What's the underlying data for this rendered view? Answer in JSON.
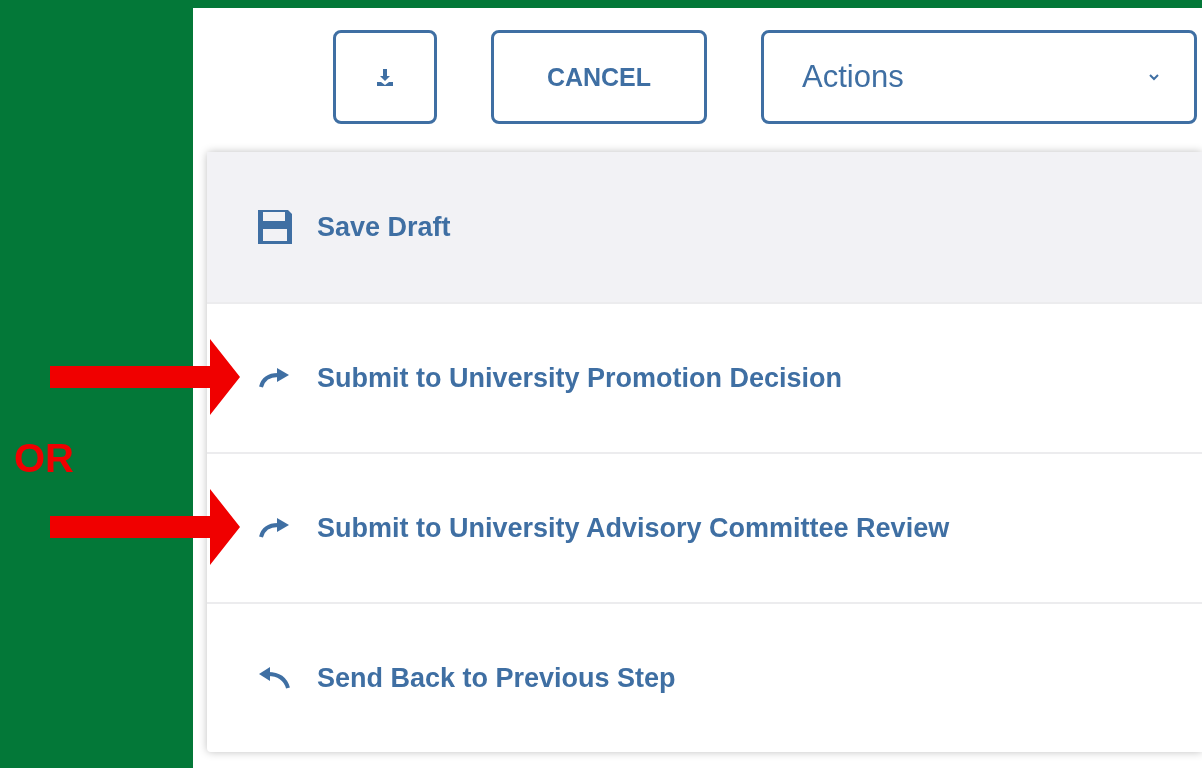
{
  "toolbar": {
    "download_button": {
      "kind": "download"
    },
    "cancel_button": "CANCEL",
    "actions_dropdown": {
      "label": "Actions",
      "expanded": true
    }
  },
  "menu_items": [
    {
      "kind": "save",
      "label": "Save Draft",
      "selected": true,
      "marked": false
    },
    {
      "kind": "forward",
      "label": "Submit to University Promotion Decision",
      "selected": false,
      "marked": true
    },
    {
      "kind": "forward",
      "label": "Submit to University Advisory Committee Review",
      "selected": false,
      "marked": true
    },
    {
      "kind": "back",
      "label": "Send Back to Previous Step",
      "selected": false,
      "marked": false
    }
  ],
  "annotation": {
    "text": "OR"
  }
}
